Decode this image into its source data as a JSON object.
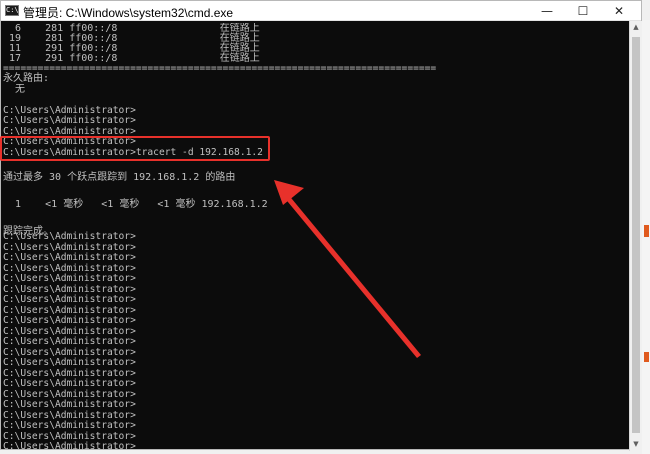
{
  "window": {
    "title": "管理员: C:\\Windows\\system32\\cmd.exe",
    "icon_text": "C:\\",
    "minimize": "—",
    "maximize": "☐",
    "close": "✕"
  },
  "console": {
    "lines": [
      "  6    281 ff00::/8                 在链路上",
      " 19    281 ff00::/8                 在链路上",
      " 11    291 ff00::/8                 在链路上",
      " 17    291 ff00::/8                 在链路上",
      "===========================================================================",
      "永久路由:",
      "  无",
      "",
      "C:\\Users\\Administrator>",
      "C:\\Users\\Administrator>",
      "C:\\Users\\Administrator>",
      "C:\\Users\\Administrator>",
      "C:\\Users\\Administrator>tracert -d 192.168.1.2",
      "",
      "通过最多 30 个跃点跟踪到 192.168.1.2 的路由",
      "",
      "  1    <1 毫秒   <1 毫秒   <1 毫秒 192.168.1.2",
      "",
      "跟踪完成。",
      "",
      "C:\\Users\\Administrator>",
      "C:\\Users\\Administrator>",
      "C:\\Users\\Administrator>",
      "C:\\Users\\Administrator>",
      "C:\\Users\\Administrator>",
      "C:\\Users\\Administrator>",
      "C:\\Users\\Administrator>",
      "C:\\Users\\Administrator>",
      "C:\\Users\\Administrator>",
      "C:\\Users\\Administrator>",
      "C:\\Users\\Administrator>",
      "C:\\Users\\Administrator>",
      "C:\\Users\\Administrator>",
      "C:\\Users\\Administrator>",
      "C:\\Users\\Administrator>",
      "C:\\Users\\Administrator>",
      "C:\\Users\\Administrator>",
      "C:\\Users\\Administrator>",
      "C:\\Users\\Administrator>",
      "C:\\Users\\Administrator>",
      "C:\\Users\\Administrator>"
    ]
  },
  "annotation": {
    "color": "#e8312b"
  },
  "colors": {
    "console_bg": "#0c0c0c",
    "console_text": "#c0c0c0"
  }
}
